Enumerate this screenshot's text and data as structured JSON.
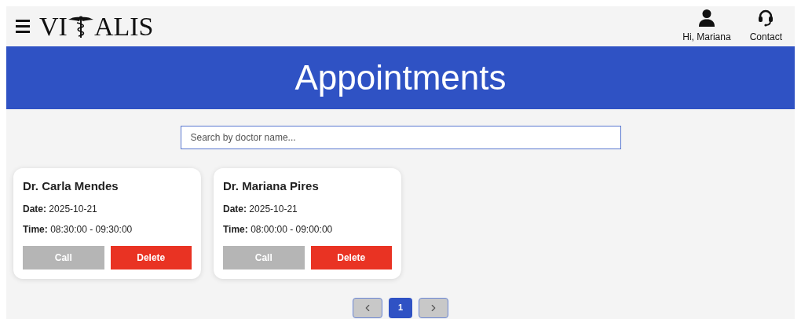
{
  "header": {
    "logo": {
      "before": "VI",
      "after": "ALIS"
    },
    "user": {
      "label": "Hi, Mariana"
    },
    "contact": {
      "label": "Contact"
    }
  },
  "banner": {
    "title": "Appointments"
  },
  "search": {
    "placeholder": "Search by doctor name..."
  },
  "appointments": [
    {
      "doctor": "Dr. Carla Mendes",
      "date_label": "Date:",
      "date": "2025-10-21",
      "time_label": "Time:",
      "time": "08:30:00 - 09:30:00",
      "call": {
        "label": "Call",
        "disabled": true
      },
      "delete": {
        "label": "Delete"
      }
    },
    {
      "doctor": "Dr. Mariana Pires",
      "date_label": "Date:",
      "date": "2025-10-21",
      "time_label": "Time:",
      "time": "08:00:00 - 09:00:00",
      "call": {
        "label": "Call",
        "disabled": true
      },
      "delete": {
        "label": "Delete"
      }
    }
  ],
  "pagination": {
    "pages": [
      {
        "label": "1",
        "selected": true
      }
    ]
  }
}
